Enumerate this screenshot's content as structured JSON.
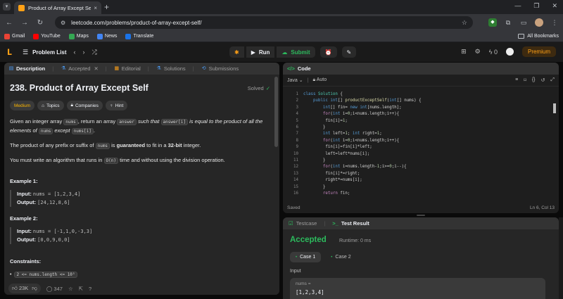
{
  "browser": {
    "tab_title": "Product of Array Except Self - L",
    "tab_close": "×",
    "new_tab": "+",
    "url": "leetcode.com/problems/product-of-array-except-self/",
    "bookmarks": [
      "Gmail",
      "YouTube",
      "Maps",
      "News",
      "Translate"
    ],
    "all_bookmarks": "All Bookmarks"
  },
  "lc_header": {
    "problem_list": "Problem List",
    "run": "Run",
    "submit": "Submit",
    "streak": "0",
    "premium": "Premium"
  },
  "left_tabs": {
    "description": "Description",
    "accepted": "Accepted",
    "editorial": "Editorial",
    "solutions": "Solutions",
    "submissions": "Submissions"
  },
  "problem": {
    "title": "238. Product of Array Except Self",
    "solved": "Solved",
    "difficulty": "Medium",
    "topics": "Topics",
    "companies": "Companies",
    "hint": "Hint",
    "p1_a": "Given an integer array ",
    "p1_nums": "nums",
    "p1_b": ", return an array ",
    "p1_answer": "answer",
    "p1_c": " such that ",
    "p1_answer_i": "answer[i]",
    "p1_d": " is equal to the product of all the elements of ",
    "p1_nums2": "nums",
    "p1_e": " except ",
    "p1_nums_i": "nums[i]",
    "p1_f": ".",
    "p2_a": "The product of any prefix or suffix of ",
    "p2_nums": "nums",
    "p2_b": " is ",
    "p2_guaranteed": "guaranteed",
    "p2_c": " to fit in a ",
    "p2_bits": "32-bit",
    "p2_d": " integer.",
    "p3_a": "You must write an algorithm that runs in ",
    "p3_on": "O(n)",
    "p3_b": " time and without using the division operation.",
    "ex1_title": "Example 1:",
    "ex1_input_label": "Input:",
    "ex1_input": "nums = [1,2,3,4]",
    "ex1_output_label": "Output:",
    "ex1_output": "[24,12,8,6]",
    "ex2_title": "Example 2:",
    "ex2_input_label": "Input:",
    "ex2_input": "nums = [-1,1,0,-3,3]",
    "ex2_output_label": "Output:",
    "ex2_output": "[0,0,9,0,0]",
    "constraints_title": "Constraints:",
    "constraint1": "2 <= nums.length <= 10⁵"
  },
  "left_footer": {
    "likes": "23K",
    "comments": "347"
  },
  "code_panel": {
    "title": "Code",
    "language": "Java",
    "mode": "Auto",
    "status": "Saved",
    "cursor": "Ln 6, Col 13"
  },
  "code_lines": [
    {
      "n": "1",
      "html": "<span class=\"kw\">class</span> <span class=\"ty\">Solution</span> {"
    },
    {
      "n": "2",
      "html": "    <span class=\"kw\">public</span> <span class=\"kw\">int</span>[] <span class=\"fn\">productExceptSelf</span>(<span class=\"kw\">int</span>[] nums) {"
    },
    {
      "n": "3",
      "html": "        <span class=\"kw\">int</span>[] fin= <span class=\"kw\">new</span> <span class=\"kw\">int</span>[nums.length];"
    },
    {
      "n": "4",
      "html": "        <span class=\"ctrl\">for</span>(<span class=\"kw\">int</span> i=<span class=\"num\">0</span>;i&lt;nums.length;i++){"
    },
    {
      "n": "5",
      "html": "         fin[i]=<span class=\"num\">1</span>;"
    },
    {
      "n": "6",
      "html": "        }"
    },
    {
      "n": "7",
      "html": "        <span class=\"kw\">int</span> left=<span class=\"num\">1</span>; <span class=\"kw\">int</span> right=<span class=\"num\">1</span>;"
    },
    {
      "n": "8",
      "html": "        <span class=\"ctrl\">for</span>(<span class=\"kw\">int</span> i=<span class=\"num\">0</span>;i&lt;nums.length;i++){"
    },
    {
      "n": "9",
      "html": "         fin[i]=fin[i]*left;"
    },
    {
      "n": "10",
      "html": "         left=left*nums[i];"
    },
    {
      "n": "11",
      "html": "        }"
    },
    {
      "n": "12",
      "html": "        <span class=\"ctrl\">for</span>(<span class=\"kw\">int</span> i=nums.length-<span class=\"num\">1</span>;i&gt;=<span class=\"num\">0</span>;i--){"
    },
    {
      "n": "13",
      "html": "         fin[i]*=right;"
    },
    {
      "n": "14",
      "html": "         right*=nums[i];"
    },
    {
      "n": "15",
      "html": "        }"
    },
    {
      "n": "16",
      "html": "        <span class=\"ctrl\">return</span> fin;"
    }
  ],
  "test_panel": {
    "testcase": "Testcase",
    "test_result": "Test Result",
    "accepted": "Accepted",
    "runtime": "Runtime: 0 ms",
    "case1": "Case 1",
    "case2": "Case 2",
    "input_label": "Input",
    "var_name": "nums =",
    "var_value": "[1,2,3,4]"
  },
  "colors": {
    "accent": "#ffa116",
    "success": "#2cbb5d",
    "medium": "#ffb800"
  }
}
